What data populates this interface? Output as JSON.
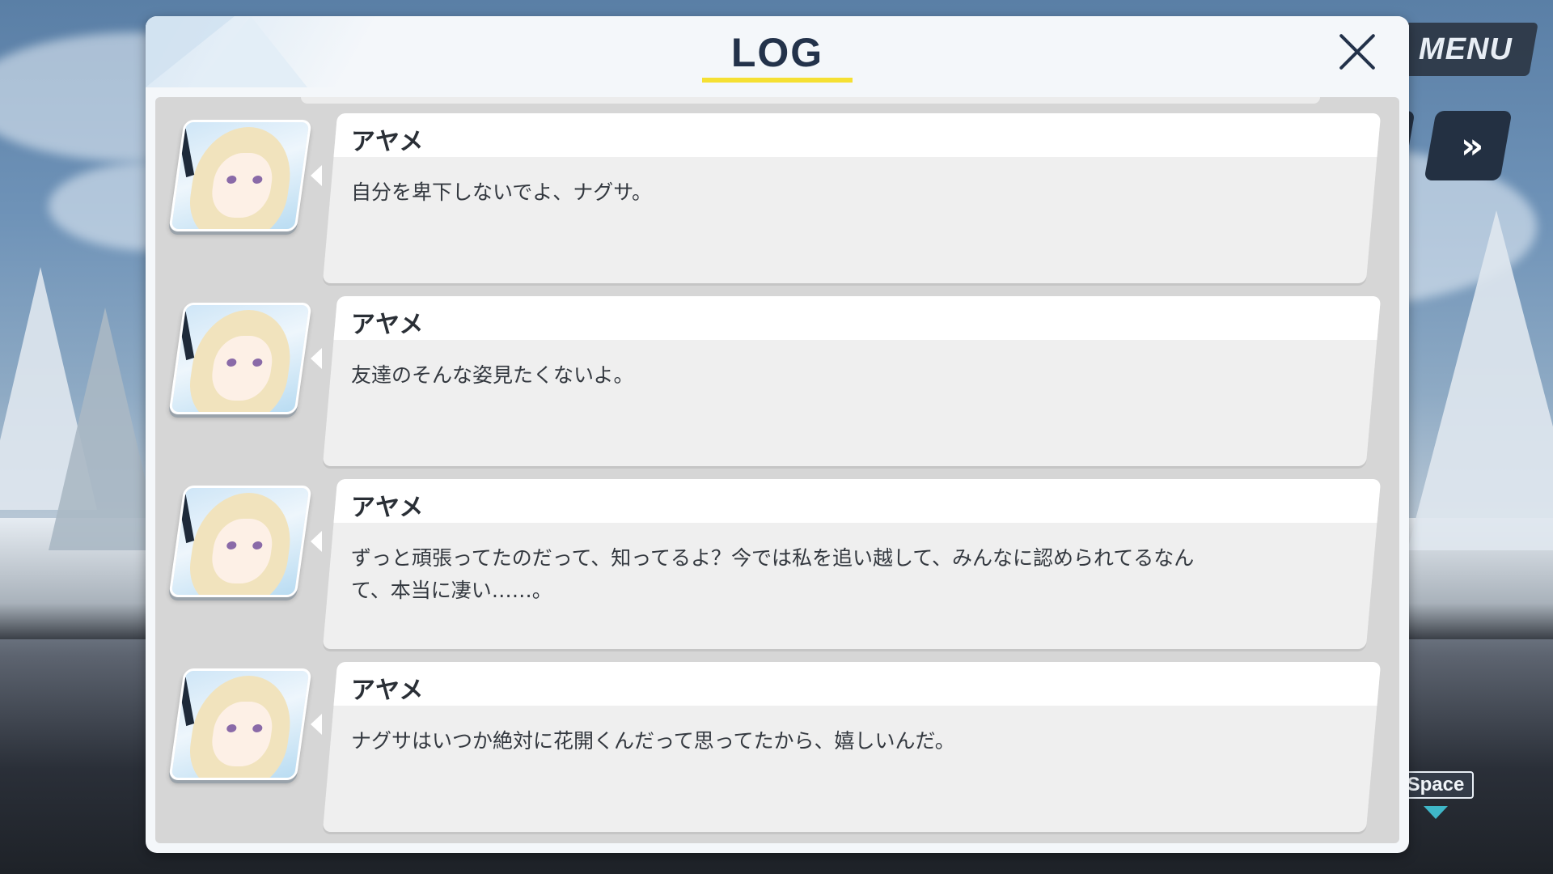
{
  "header": {
    "title": "LOG"
  },
  "hud": {
    "menu_label": "MENU",
    "skip_glyph": "»",
    "space_label": "Space"
  },
  "log_entries": [
    {
      "speaker": "アヤメ",
      "text": "自分を卑下しないでよ、ナグサ。"
    },
    {
      "speaker": "アヤメ",
      "text": "友達のそんな姿見たくないよ。"
    },
    {
      "speaker": "アヤメ",
      "text": "ずっと頑張ってたのだって、知ってるよ？今では私を追い越して、みんなに認められてるなんて、本当に凄い……。"
    },
    {
      "speaker": "アヤメ",
      "text": "ナグサはいつか絶対に花開くんだって思ってたから、嬉しいんだ。"
    }
  ],
  "colors": {
    "title": "#23324a",
    "underline": "#f5e033",
    "panel": "#f4f7fa",
    "list_bg": "#d6d6d6"
  }
}
